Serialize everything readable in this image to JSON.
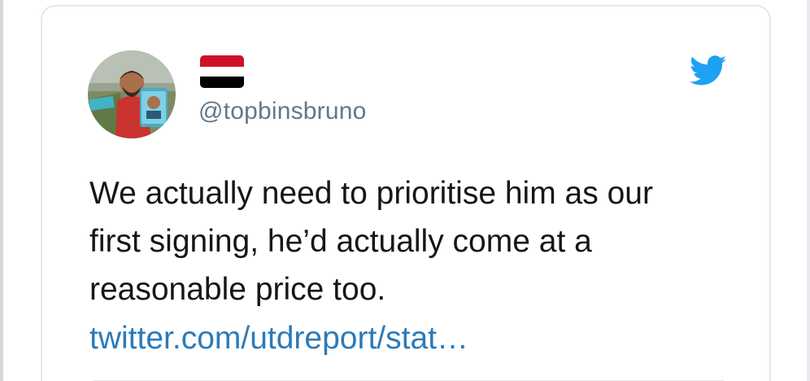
{
  "tweet": {
    "handle": "@topbinsbruno",
    "avatar_icon": "user-photo-avatar",
    "flag_icon": "yemen-flag-icon",
    "flag_colors": [
      "#ce1126",
      "#ffffff",
      "#000000"
    ],
    "bird_icon": "twitter-bird-icon",
    "brand_color": "#1da1f2",
    "text_lines": [
      "We actually need to prioritise him as our",
      "first signing, he’d actually come at a",
      "reasonable price too."
    ],
    "link_text": "twitter.com/utdreport/stat…",
    "link_color": "#2b7bb9"
  }
}
